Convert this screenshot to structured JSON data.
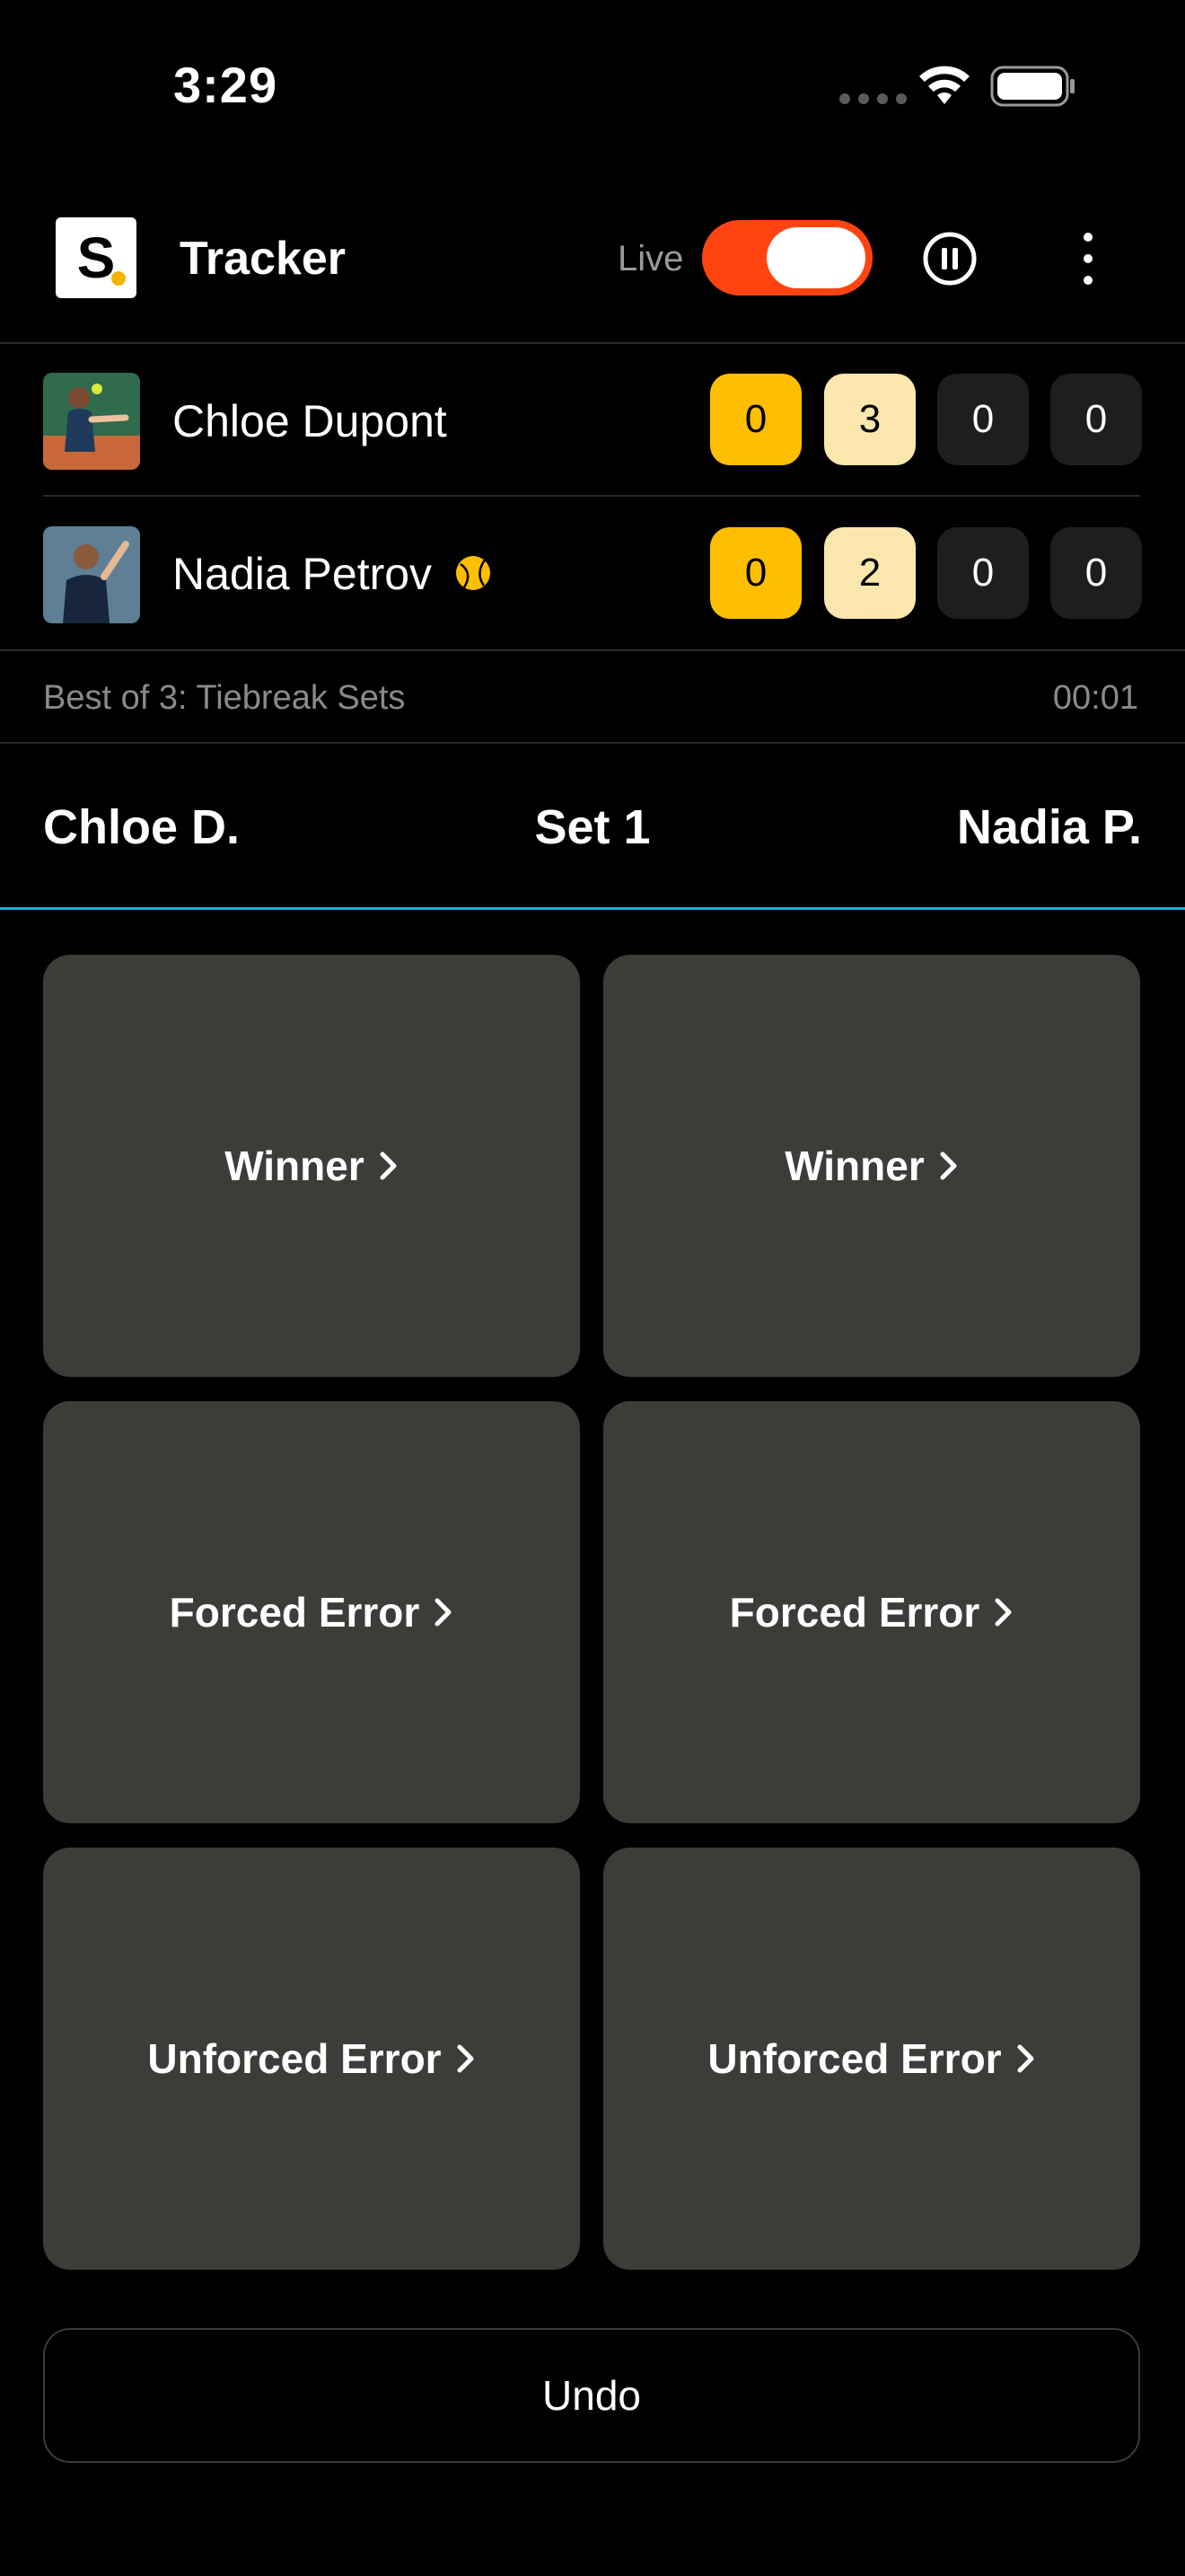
{
  "status_bar": {
    "time": "3:29"
  },
  "header": {
    "logo_letter": "S",
    "title": "Tracker",
    "live_label": "Live",
    "live_on": true,
    "accent_color": "#ff4411"
  },
  "players": [
    {
      "name": "Chloe Dupont",
      "serving": false,
      "scores": [
        "0",
        "3",
        "0",
        "0"
      ]
    },
    {
      "name": "Nadia Petrov",
      "serving": true,
      "scores": [
        "0",
        "2",
        "0",
        "0"
      ]
    }
  ],
  "match": {
    "format": "Best of 3: Tiebreak Sets",
    "elapsed": "00:01"
  },
  "set_bar": {
    "left_player": "Chloe D.",
    "set_label": "Set 1",
    "right_player": "Nadia P."
  },
  "actions": {
    "winner": "Winner",
    "forced_error": "Forced Error",
    "unforced_error": "Unforced Error"
  },
  "undo_label": "Undo",
  "colors": {
    "game_score": "#ffbf00",
    "set_score": "#fbe7ad",
    "card": "#3d3c39",
    "set_underline": "#2ba7d6"
  }
}
